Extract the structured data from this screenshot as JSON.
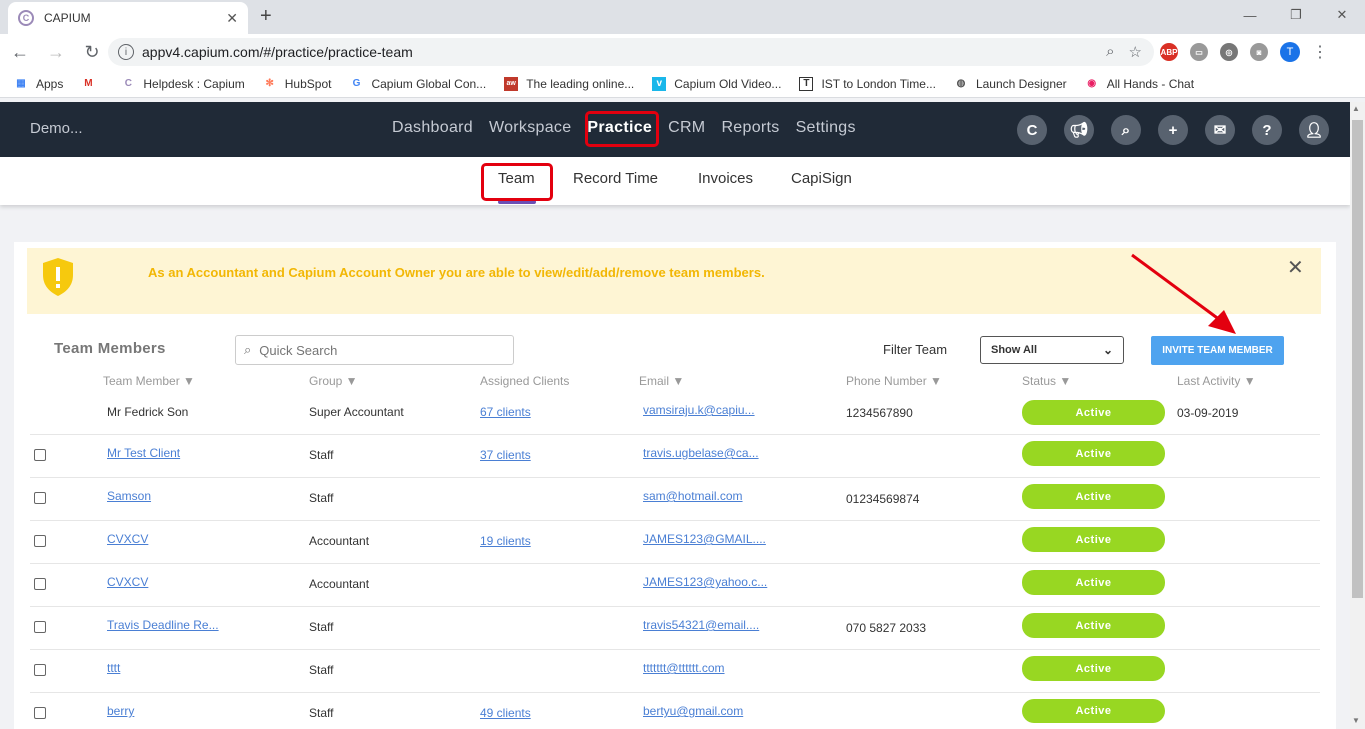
{
  "browser": {
    "tab_title": "CAPIUM",
    "url": "appv4.capium.com/#/practice/practice-team",
    "profile_initial": "T",
    "bookmarks": [
      "Apps",
      "Helpdesk : Capium",
      "HubSpot",
      "Capium Global Con...",
      "The leading online...",
      "Capium Old Video...",
      "IST to London Time...",
      "Launch Designer",
      "All Hands - Chat"
    ]
  },
  "header": {
    "brand": "Demo...",
    "nav": [
      "Dashboard",
      "Workspace",
      "Practice",
      "CRM",
      "Reports",
      "Settings"
    ],
    "active_nav": "Practice"
  },
  "subnav": {
    "items": [
      "Team",
      "Record Time",
      "Invoices",
      "CapiSign"
    ],
    "active": "Team"
  },
  "alert": {
    "text": "As an Accountant and Capium Account Owner you are able to view/edit/add/remove team members."
  },
  "toolbar": {
    "title": "Team Members",
    "search_placeholder": "Quick Search",
    "filter_label": "Filter Team",
    "filter_value": "Show All",
    "invite_label": "INVITE TEAM MEMBER"
  },
  "table": {
    "headers": {
      "member": "Team Member ▼",
      "group": "Group ▼",
      "clients": "Assigned Clients",
      "email": "Email ▼",
      "phone": "Phone Number ▼",
      "status": "Status ▼",
      "activity": "Last Activity ▼"
    },
    "rows": [
      {
        "name": "Mr Fedrick Son",
        "group": "Super Accountant",
        "clients": "67 clients",
        "email": "vamsiraju.k@capiu...",
        "phone": "1234567890",
        "status": "Active",
        "activity": "03-09-2019"
      },
      {
        "name": "Mr Test Client",
        "group": "Staff",
        "clients": "37 clients",
        "email": "travis.ugbelase@ca...",
        "phone": "",
        "status": "Active",
        "activity": ""
      },
      {
        "name": "Samson",
        "group": "Staff",
        "clients": "",
        "email": "sam@hotmail.com",
        "phone": "01234569874",
        "status": "Active",
        "activity": ""
      },
      {
        "name": "CVXCV",
        "group": "Accountant",
        "clients": "19 clients",
        "email": "JAMES123@GMAIL....",
        "phone": "",
        "status": "Active",
        "activity": ""
      },
      {
        "name": "CVXCV",
        "group": "Accountant",
        "clients": "",
        "email": "JAMES123@yahoo.c...",
        "phone": "",
        "status": "Active",
        "activity": ""
      },
      {
        "name": "Travis Deadline Re...",
        "group": "Staff",
        "clients": "",
        "email": "travis54321@email....",
        "phone": "070 5827 2033",
        "status": "Active",
        "activity": ""
      },
      {
        "name": "tttt",
        "group": "Staff",
        "clients": "",
        "email": "ttttttt@tttttt.com",
        "phone": "",
        "status": "Active",
        "activity": ""
      },
      {
        "name": "berry",
        "group": "Staff",
        "clients": "49 clients",
        "email": "bertyu@gmail.com",
        "phone": "",
        "status": "Active",
        "activity": ""
      }
    ]
  },
  "colors": {
    "header_bg": "#202a37",
    "status_active": "#98d722",
    "invite_btn": "#4ea3ef",
    "alert_bg": "#fef5d4",
    "alert_text": "#f2b705",
    "highlight": "#e3000f"
  }
}
